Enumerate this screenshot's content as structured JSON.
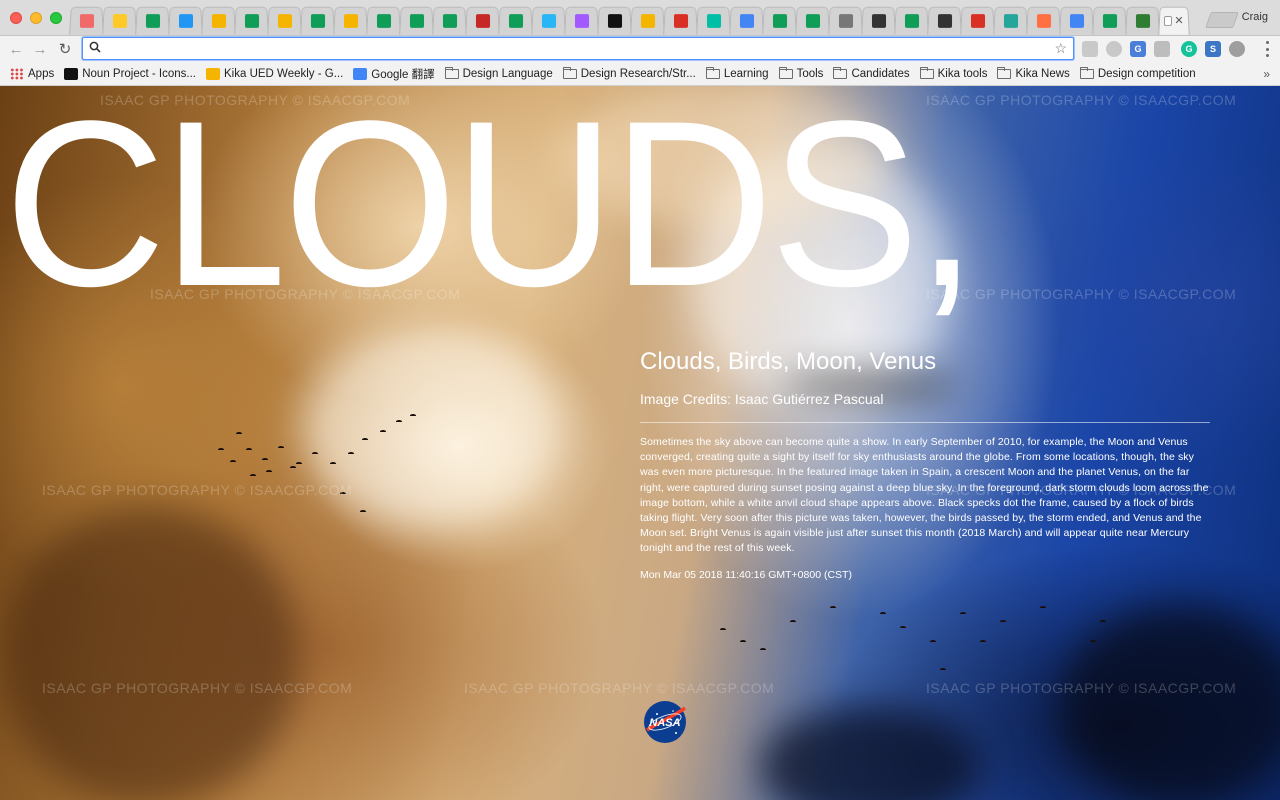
{
  "browser": {
    "profile_name": "Craig",
    "tabs": [
      {
        "icon": "asana-icon",
        "color": "#f06a6a"
      },
      {
        "icon": "firebase-icon",
        "color": "#ffca28"
      },
      {
        "icon": "google-sheets-icon",
        "color": "#0f9d58"
      },
      {
        "icon": "sync-icon",
        "color": "#2196f3"
      },
      {
        "icon": "google-drive-icon",
        "color": "#f4b400"
      },
      {
        "icon": "google-sheets-icon",
        "color": "#0f9d58"
      },
      {
        "icon": "google-drive-icon",
        "color": "#f4b400"
      },
      {
        "icon": "google-drive-icon",
        "color": "#0f9d58"
      },
      {
        "icon": "google-drive-icon",
        "color": "#f4b400"
      },
      {
        "icon": "google-sheets-icon",
        "color": "#0f9d58"
      },
      {
        "icon": "google-sheets-icon",
        "color": "#0f9d58"
      },
      {
        "icon": "google-sheets-icon",
        "color": "#0f9d58"
      },
      {
        "icon": "dr-icon",
        "color": "#c62828"
      },
      {
        "icon": "google-sheets-icon",
        "color": "#0f9d58"
      },
      {
        "icon": "bird-icon",
        "color": "#29b6f6"
      },
      {
        "icon": "figma-icon",
        "color": "#a259ff"
      },
      {
        "icon": "medium-icon",
        "color": "#111111"
      },
      {
        "icon": "google-drive-icon",
        "color": "#f4b400"
      },
      {
        "icon": "gmail-icon",
        "color": "#d93025"
      },
      {
        "icon": "chat-bubble-icon",
        "color": "#00bfa5"
      },
      {
        "icon": "google-docs-icon",
        "color": "#4285f4"
      },
      {
        "icon": "google-sheets-icon",
        "color": "#0f9d58"
      },
      {
        "icon": "google-sheets-icon",
        "color": "#0f9d58"
      },
      {
        "icon": "magnet-icon",
        "color": "#777777"
      },
      {
        "icon": "emblem-icon",
        "color": "#333333"
      },
      {
        "icon": "google-sheets-icon",
        "color": "#0f9d58"
      },
      {
        "icon": "trello-icon",
        "color": "#333333"
      },
      {
        "icon": "gmail-icon",
        "color": "#d93025"
      },
      {
        "icon": "refresh-app-icon",
        "color": "#26a69a"
      },
      {
        "icon": "orange-app-icon",
        "color": "#ff7043"
      },
      {
        "icon": "google-docs-icon",
        "color": "#4285f4"
      },
      {
        "icon": "google-sheets-icon",
        "color": "#0f9d58"
      },
      {
        "icon": "grid-app-icon",
        "color": "#2e7d32"
      }
    ],
    "active_tab": {
      "icon": "page-icon",
      "close_label": "✕"
    },
    "omnibox": {
      "value": "",
      "placeholder": ""
    },
    "bookmarks": [
      {
        "label": "Apps",
        "icon": "apps-grid-icon"
      },
      {
        "label": "Noun Project - Icons...",
        "icon": "noun-project-icon"
      },
      {
        "label": "Kika UED Weekly - G...",
        "icon": "google-drive-icon"
      },
      {
        "label": "Google 翻譯",
        "icon": "google-translate-icon"
      },
      {
        "label": "Design Language",
        "icon": "folder-icon"
      },
      {
        "label": "Design Research/Str...",
        "icon": "folder-icon"
      },
      {
        "label": "Learning",
        "icon": "folder-icon"
      },
      {
        "label": "Tools",
        "icon": "folder-icon"
      },
      {
        "label": "Candidates",
        "icon": "folder-icon"
      },
      {
        "label": "Kika tools",
        "icon": "folder-icon"
      },
      {
        "label": "Kika News",
        "icon": "folder-icon"
      },
      {
        "label": "Design competition",
        "icon": "folder-icon"
      }
    ],
    "bookmarks_overflow": "»"
  },
  "page": {
    "big_title": "CLOUDS,",
    "watermark": "ISAAC GP   PHOTOGRAPHY  ©  ISAACGP.COM",
    "apod": {
      "title": "Clouds, Birds, Moon, Venus",
      "credit": "Image Credits: Isaac Gutiérrez Pascual",
      "description": "Sometimes the sky above can become quite a show. In early September of 2010, for example, the Moon and Venus converged, creating quite a sight by itself for sky enthusiasts around the globe. From some locations, though, the sky was even more picturesque. In the featured image taken in Spain, a crescent Moon and the planet Venus, on the far right, were captured during sunset posing against a deep blue sky. In the foreground, dark storm clouds loom across the image bottom, while a white anvil cloud shape appears above. Black specks dot the frame, caused by a flock of birds taking flight. Very soon after this picture was taken, however, the birds passed by, the storm ended, and Venus and the Moon set. Bright Venus is again visible just after sunset this month (2018 March) and will appear quite near Mercury tonight and the rest of this week.",
      "date": "Mon Mar 05 2018 11:40:16 GMT+0800 (CST)",
      "logo_text": "NASA"
    }
  }
}
